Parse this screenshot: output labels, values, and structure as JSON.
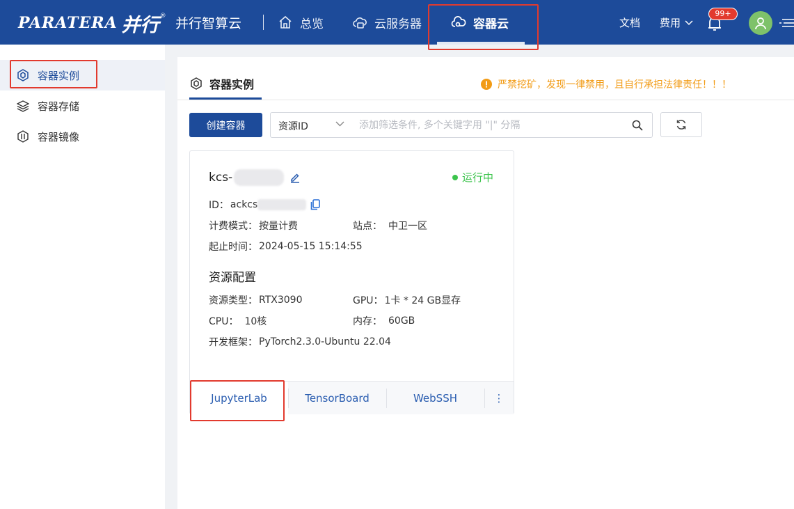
{
  "header": {
    "logo_text": "PARATERA",
    "logo_cn": "并行",
    "logo_reg": "®",
    "brand": "并行智算云",
    "nav": [
      {
        "label": "总览",
        "icon": "home-icon"
      },
      {
        "label": "云服务器",
        "icon": "cloud-server-icon"
      },
      {
        "label": "容器云",
        "icon": "container-cloud-icon",
        "active": true
      }
    ],
    "docs_label": "文档",
    "fee_label": "费用",
    "notification_count": "99+"
  },
  "sidebar": {
    "items": [
      {
        "label": "容器实例",
        "icon": "container-instance-icon",
        "active": true
      },
      {
        "label": "容器存储",
        "icon": "layers-icon"
      },
      {
        "label": "容器镜像",
        "icon": "image-icon"
      }
    ]
  },
  "main": {
    "title": "容器实例",
    "warning": "严禁挖矿，发现一律禁用，且自行承担法律责任！！！",
    "create_button": "创建容器",
    "filter": {
      "select_value": "资源ID",
      "placeholder": "添加筛选条件, 多个关键字用 \"|\" 分隔"
    }
  },
  "card": {
    "name_prefix": "kcs-",
    "status": "运行中",
    "id_label": "ID：",
    "id_value": "ackcs",
    "billing_label": "计费模式：",
    "billing_value": "按量计费",
    "site_label": "站点：",
    "site_value": "中卫一区",
    "time_label": "起止时间：",
    "time_value": "2024-05-15 15:14:55",
    "resource_title": "资源配置",
    "type_label": "资源类型：",
    "type_value": "RTX3090",
    "gpu_label": "GPU：",
    "gpu_value": "1卡 * 24 GB显存",
    "cpu_label": "CPU：",
    "cpu_value": "10核",
    "mem_label": "内存：",
    "mem_value": "60GB",
    "fw_label": "开发框架：",
    "fw_value": "PyTorch2.3.0-Ubuntu 22.04",
    "actions": [
      "JupyterLab",
      "TensorBoard",
      "WebSSH"
    ],
    "more_label": "⋮"
  },
  "colors": {
    "header_bg": "#1d4b9a",
    "highlight": "#e23a2e",
    "status_green": "#3cc44c",
    "warning_orange": "#f29b14",
    "link_blue": "#2a5db0"
  }
}
